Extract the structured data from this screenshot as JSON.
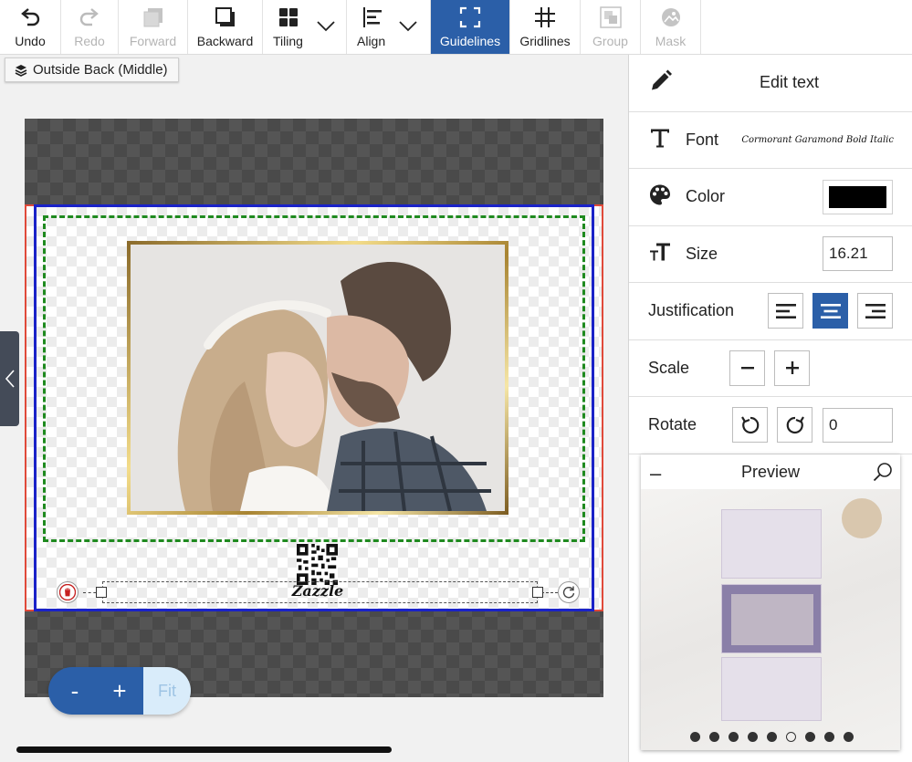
{
  "toolbar": {
    "undo": "Undo",
    "redo": "Redo",
    "forward": "Forward",
    "backward": "Backward",
    "tiling": "Tiling",
    "align": "Align",
    "guidelines": "Guidelines",
    "gridlines": "Gridlines",
    "group": "Group",
    "mask": "Mask"
  },
  "layer": {
    "name": "Outside Back (Middle)"
  },
  "canvas": {
    "brand_text": "Zazzle"
  },
  "zoom": {
    "minus": "-",
    "plus": "+",
    "fit": "Fit"
  },
  "panel": {
    "title": "Edit text",
    "font_label": "Font",
    "font_value": "Cormorant Garamond Bold Italic",
    "color_label": "Color",
    "color_value": "#000000",
    "size_label": "Size",
    "size_value": "16.21",
    "justification_label": "Justification",
    "justification_selected": "center",
    "scale_label": "Scale",
    "rotate_label": "Rotate",
    "rotate_value": "0"
  },
  "preview": {
    "title": "Preview",
    "page_count": 9,
    "active_page": 6
  },
  "colors": {
    "accent": "#2b5fa8",
    "guide_blue": "#1a22c8",
    "guide_green": "#1f8a1f",
    "bleed_red": "#e04a3a"
  }
}
